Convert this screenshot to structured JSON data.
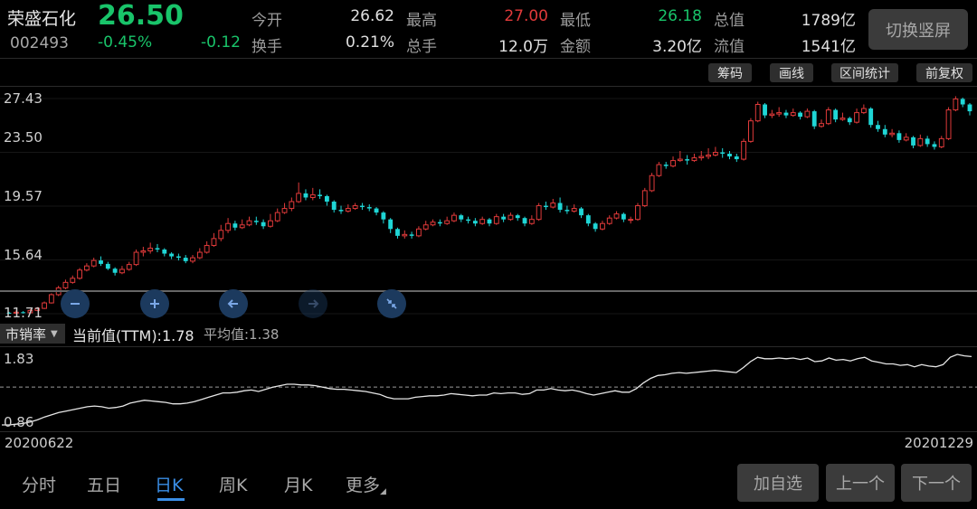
{
  "quote": {
    "name": "荣盛石化",
    "price": "26.50",
    "code": "002493",
    "change_pct": "-0.45%",
    "change": "-0.12",
    "fields": [
      {
        "label": "今开",
        "value": "26.62",
        "color": "normal"
      },
      {
        "label": "最高",
        "value": "27.00",
        "color": "red"
      },
      {
        "label": "最低",
        "value": "26.18",
        "color": "green"
      },
      {
        "label": "总值",
        "value": "1789亿",
        "color": "normal"
      },
      {
        "label": "换手",
        "value": "0.21%",
        "color": "normal"
      },
      {
        "label": "总手",
        "value": "12.0万",
        "color": "normal"
      },
      {
        "label": "金额",
        "value": "3.20亿",
        "color": "normal"
      },
      {
        "label": "流值",
        "value": "1541亿",
        "color": "normal"
      }
    ],
    "switch_label": "切换竖屏"
  },
  "toolbar": {
    "chip": "筹码",
    "draw": "画线",
    "range_stats": "区间统计",
    "adjust": "前复权"
  },
  "colors": {
    "up": "#e03a3a",
    "down": "#1fd6d6",
    "line": "#e6e6e6",
    "accent": "#3a8ee6"
  },
  "chart_data": {
    "type": "candlestick",
    "y_ticks": [
      "27.43",
      "23.50",
      "19.57",
      "15.64",
      "11.71"
    ],
    "ylim": [
      11.71,
      27.43
    ],
    "candles": [
      [
        11.78,
        11.75,
        11.7,
        11.85
      ],
      [
        11.75,
        11.82,
        11.7,
        11.95
      ],
      [
        11.82,
        11.78,
        11.72,
        11.9
      ],
      [
        11.78,
        11.95,
        11.75,
        12.05
      ],
      [
        11.95,
        12.1,
        11.9,
        12.2
      ],
      [
        12.1,
        12.5,
        12.05,
        12.6
      ],
      [
        12.5,
        13.1,
        12.45,
        13.2
      ],
      [
        13.1,
        13.6,
        13.0,
        13.75
      ],
      [
        13.6,
        14.0,
        13.5,
        14.2
      ],
      [
        14.0,
        14.3,
        13.9,
        14.5
      ],
      [
        14.3,
        14.9,
        14.2,
        15.05
      ],
      [
        14.9,
        15.2,
        14.8,
        15.4
      ],
      [
        15.2,
        15.6,
        15.1,
        15.8
      ],
      [
        15.6,
        15.35,
        15.2,
        15.9
      ],
      [
        15.35,
        15.0,
        14.9,
        15.5
      ],
      [
        15.0,
        14.7,
        14.5,
        15.1
      ],
      [
        14.7,
        14.95,
        14.6,
        15.2
      ],
      [
        14.95,
        15.3,
        14.85,
        15.5
      ],
      [
        15.3,
        16.2,
        15.2,
        16.4
      ],
      [
        16.2,
        16.3,
        15.9,
        16.6
      ],
      [
        16.3,
        16.5,
        16.1,
        16.9
      ],
      [
        16.5,
        16.4,
        16.2,
        16.8
      ],
      [
        16.4,
        16.1,
        15.9,
        16.5
      ],
      [
        16.1,
        15.9,
        15.7,
        16.2
      ],
      [
        15.9,
        15.8,
        15.6,
        16.1
      ],
      [
        15.8,
        15.55,
        15.4,
        16.0
      ],
      [
        15.55,
        15.8,
        15.4,
        16.0
      ],
      [
        15.8,
        16.2,
        15.7,
        16.5
      ],
      [
        16.2,
        16.7,
        16.1,
        17.0
      ],
      [
        16.7,
        17.2,
        16.6,
        17.6
      ],
      [
        17.2,
        17.8,
        17.0,
        18.2
      ],
      [
        17.8,
        18.3,
        17.6,
        18.7
      ],
      [
        18.3,
        18.0,
        17.8,
        18.5
      ],
      [
        18.0,
        18.2,
        17.9,
        18.6
      ],
      [
        18.2,
        18.5,
        18.1,
        18.8
      ],
      [
        18.5,
        18.4,
        18.2,
        18.8
      ],
      [
        18.4,
        18.1,
        17.9,
        18.6
      ],
      [
        18.1,
        18.5,
        18.0,
        19.0
      ],
      [
        18.5,
        19.1,
        18.4,
        19.4
      ],
      [
        19.1,
        19.4,
        19.0,
        19.8
      ],
      [
        19.4,
        19.9,
        19.2,
        20.2
      ],
      [
        19.9,
        20.5,
        19.8,
        21.3
      ],
      [
        20.5,
        20.2,
        20.0,
        20.8
      ],
      [
        20.2,
        20.4,
        20.0,
        20.9
      ],
      [
        20.4,
        20.3,
        20.1,
        20.8
      ],
      [
        20.3,
        19.9,
        19.6,
        20.4
      ],
      [
        19.9,
        19.3,
        19.1,
        20.0
      ],
      [
        19.3,
        19.2,
        19.0,
        19.6
      ],
      [
        19.2,
        19.4,
        19.1,
        19.7
      ],
      [
        19.4,
        19.6,
        19.3,
        19.8
      ],
      [
        19.6,
        19.5,
        19.3,
        19.8
      ],
      [
        19.5,
        19.4,
        19.2,
        19.7
      ],
      [
        19.4,
        19.1,
        18.9,
        19.5
      ],
      [
        19.1,
        18.6,
        18.3,
        19.2
      ],
      [
        18.6,
        17.9,
        17.6,
        18.7
      ],
      [
        17.9,
        17.4,
        17.2,
        18.0
      ],
      [
        17.4,
        17.5,
        17.2,
        17.8
      ],
      [
        17.5,
        17.4,
        17.2,
        17.7
      ],
      [
        17.4,
        17.9,
        17.3,
        18.1
      ],
      [
        17.9,
        18.2,
        17.8,
        18.5
      ],
      [
        18.2,
        18.4,
        18.1,
        18.6
      ],
      [
        18.4,
        18.3,
        18.1,
        18.6
      ],
      [
        18.3,
        18.5,
        18.2,
        18.8
      ],
      [
        18.5,
        18.9,
        18.4,
        19.1
      ],
      [
        18.9,
        18.6,
        18.4,
        19.0
      ],
      [
        18.6,
        18.5,
        18.3,
        18.8
      ],
      [
        18.5,
        18.3,
        18.1,
        18.7
      ],
      [
        18.3,
        18.6,
        18.2,
        18.8
      ],
      [
        18.6,
        18.3,
        18.1,
        18.7
      ],
      [
        18.3,
        18.8,
        18.2,
        19.0
      ],
      [
        18.8,
        18.6,
        18.4,
        19.0
      ],
      [
        18.6,
        18.9,
        18.5,
        19.1
      ],
      [
        18.9,
        18.7,
        18.5,
        19.0
      ],
      [
        18.7,
        18.3,
        18.1,
        18.8
      ],
      [
        18.3,
        18.6,
        18.2,
        18.9
      ],
      [
        18.6,
        19.6,
        18.5,
        19.8
      ],
      [
        19.6,
        19.5,
        19.3,
        19.9
      ],
      [
        19.5,
        19.8,
        19.4,
        20.1
      ],
      [
        19.8,
        19.3,
        19.1,
        20.2
      ],
      [
        19.3,
        19.2,
        19.0,
        19.6
      ],
      [
        19.2,
        19.4,
        19.1,
        19.7
      ],
      [
        19.4,
        18.9,
        18.7,
        19.5
      ],
      [
        18.9,
        18.3,
        18.1,
        19.0
      ],
      [
        18.3,
        17.9,
        17.7,
        18.4
      ],
      [
        17.9,
        18.3,
        17.8,
        18.5
      ],
      [
        18.3,
        18.7,
        18.2,
        18.9
      ],
      [
        18.7,
        19.0,
        18.6,
        19.2
      ],
      [
        19.0,
        18.6,
        18.4,
        19.1
      ],
      [
        18.6,
        18.6,
        18.3,
        18.8
      ],
      [
        18.6,
        19.6,
        18.5,
        19.8
      ],
      [
        19.6,
        20.7,
        19.5,
        20.9
      ],
      [
        20.7,
        21.8,
        20.6,
        22.0
      ],
      [
        21.8,
        22.6,
        21.7,
        22.8
      ],
      [
        22.6,
        22.5,
        22.3,
        22.8
      ],
      [
        22.5,
        22.9,
        22.4,
        23.2
      ],
      [
        22.9,
        23.0,
        22.8,
        23.6
      ],
      [
        23.0,
        22.9,
        22.6,
        23.3
      ],
      [
        22.9,
        23.1,
        22.8,
        23.4
      ],
      [
        23.1,
        23.2,
        22.9,
        23.6
      ],
      [
        23.2,
        23.3,
        23.0,
        23.8
      ],
      [
        23.3,
        23.5,
        23.2,
        23.9
      ],
      [
        23.5,
        23.4,
        23.1,
        23.8
      ],
      [
        23.4,
        23.2,
        23.0,
        23.6
      ],
      [
        23.2,
        23.0,
        22.8,
        23.4
      ],
      [
        23.0,
        24.3,
        22.9,
        24.5
      ],
      [
        24.3,
        25.8,
        24.2,
        26.0
      ],
      [
        25.8,
        27.0,
        25.7,
        27.2
      ],
      [
        27.0,
        26.2,
        26.0,
        27.1
      ],
      [
        26.2,
        26.3,
        26.0,
        26.6
      ],
      [
        26.3,
        26.4,
        26.1,
        26.8
      ],
      [
        26.4,
        26.2,
        26.0,
        26.6
      ],
      [
        26.2,
        26.4,
        26.1,
        26.7
      ],
      [
        26.4,
        26.1,
        25.9,
        26.5
      ],
      [
        26.1,
        26.5,
        26.0,
        26.7
      ],
      [
        26.5,
        25.4,
        25.2,
        26.6
      ],
      [
        25.4,
        25.6,
        25.3,
        25.9
      ],
      [
        25.6,
        26.6,
        25.5,
        26.8
      ],
      [
        26.6,
        25.9,
        25.7,
        26.7
      ],
      [
        25.9,
        26.0,
        25.8,
        26.4
      ],
      [
        26.0,
        25.7,
        25.5,
        26.1
      ],
      [
        25.7,
        26.4,
        25.6,
        26.7
      ],
      [
        26.4,
        26.7,
        26.3,
        27.0
      ],
      [
        26.7,
        25.5,
        25.3,
        26.8
      ],
      [
        25.5,
        25.2,
        25.0,
        25.8
      ],
      [
        25.2,
        24.8,
        24.6,
        25.5
      ],
      [
        24.8,
        24.9,
        24.6,
        25.2
      ],
      [
        24.9,
        24.4,
        24.2,
        25.1
      ],
      [
        24.4,
        24.6,
        24.3,
        24.9
      ],
      [
        24.6,
        24.0,
        23.8,
        24.7
      ],
      [
        24.0,
        24.5,
        23.9,
        24.8
      ],
      [
        24.5,
        24.1,
        23.9,
        24.7
      ],
      [
        24.1,
        23.9,
        23.7,
        24.3
      ],
      [
        23.9,
        24.5,
        23.8,
        24.7
      ],
      [
        24.5,
        26.6,
        24.4,
        26.8
      ],
      [
        26.6,
        27.4,
        26.5,
        27.6
      ],
      [
        27.4,
        27.0,
        26.8,
        27.5
      ],
      [
        27.0,
        26.5,
        26.2,
        27.1
      ]
    ]
  },
  "indicator": {
    "selector": "市销率",
    "current": "当前值(TTM):1.78",
    "average": "平均值:1.38",
    "y_ticks": [
      "1.83",
      "0.86"
    ],
    "ylim": [
      0.86,
      1.83
    ],
    "avg_value": 1.38,
    "values": [
      0.86,
      0.86,
      0.87,
      0.88,
      0.9,
      0.93,
      0.97,
      1.0,
      1.03,
      1.05,
      1.07,
      1.09,
      1.11,
      1.12,
      1.11,
      1.09,
      1.1,
      1.12,
      1.16,
      1.18,
      1.2,
      1.19,
      1.18,
      1.17,
      1.15,
      1.15,
      1.16,
      1.18,
      1.21,
      1.24,
      1.27,
      1.3,
      1.3,
      1.31,
      1.33,
      1.34,
      1.32,
      1.35,
      1.38,
      1.4,
      1.42,
      1.42,
      1.41,
      1.41,
      1.4,
      1.38,
      1.36,
      1.35,
      1.35,
      1.34,
      1.33,
      1.32,
      1.3,
      1.28,
      1.24,
      1.22,
      1.22,
      1.22,
      1.24,
      1.25,
      1.26,
      1.26,
      1.27,
      1.29,
      1.28,
      1.27,
      1.26,
      1.27,
      1.27,
      1.3,
      1.29,
      1.3,
      1.3,
      1.28,
      1.29,
      1.34,
      1.34,
      1.36,
      1.34,
      1.33,
      1.34,
      1.32,
      1.29,
      1.27,
      1.29,
      1.31,
      1.33,
      1.31,
      1.31,
      1.36,
      1.44,
      1.5,
      1.54,
      1.55,
      1.57,
      1.58,
      1.57,
      1.58,
      1.59,
      1.6,
      1.61,
      1.6,
      1.59,
      1.58,
      1.65,
      1.73,
      1.79,
      1.77,
      1.77,
      1.78,
      1.77,
      1.78,
      1.76,
      1.78,
      1.73,
      1.74,
      1.78,
      1.75,
      1.76,
      1.74,
      1.77,
      1.79,
      1.74,
      1.72,
      1.7,
      1.7,
      1.68,
      1.69,
      1.66,
      1.69,
      1.67,
      1.66,
      1.69,
      1.79,
      1.83,
      1.81,
      1.8
    ]
  },
  "dates": {
    "start": "20200622",
    "end": "20201229"
  },
  "period_tabs": [
    {
      "label": "分时"
    },
    {
      "label": "五日"
    },
    {
      "label": "日K",
      "active": true
    },
    {
      "label": "周K"
    },
    {
      "label": "月K"
    },
    {
      "label": "更多"
    }
  ],
  "buttons": {
    "add": "加自选",
    "prev": "上一个",
    "next": "下一个"
  }
}
